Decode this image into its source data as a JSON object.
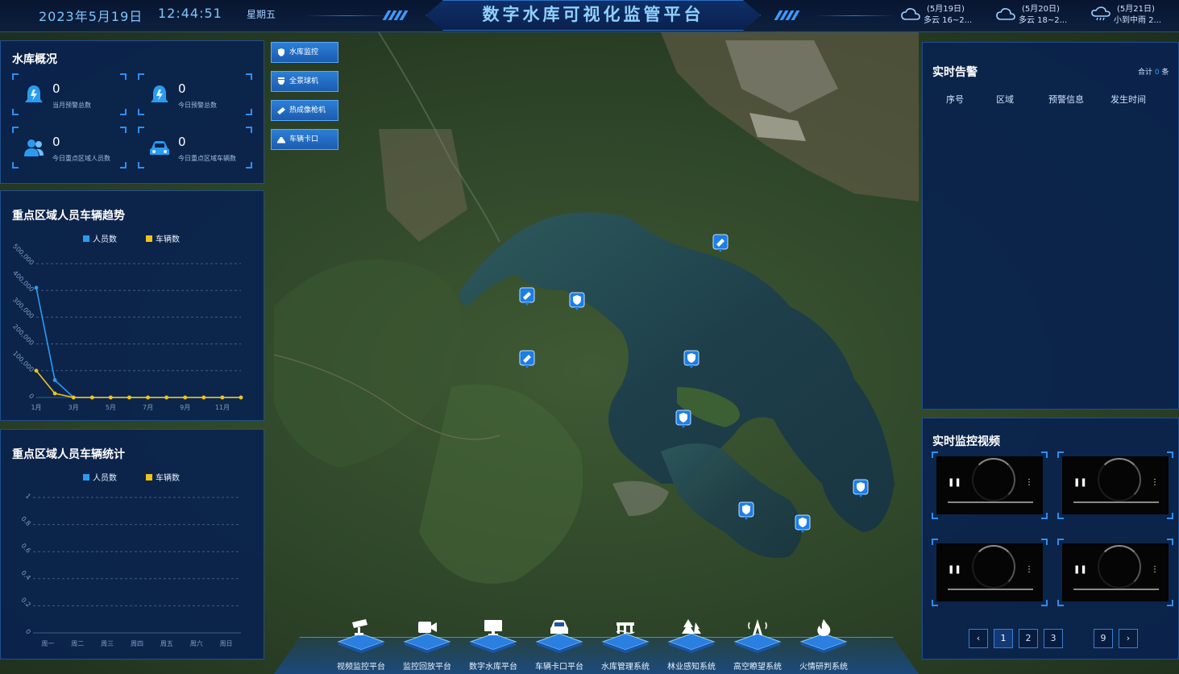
{
  "header": {
    "date": "2023年5月19日",
    "time": "12:44:51",
    "weekday": "星期五",
    "title": "数字水库可视化监管平台",
    "weather": [
      {
        "date": "(5月19日)",
        "desc": "多云 16~2...",
        "icon": "cloud-icon"
      },
      {
        "date": "(5月20日)",
        "desc": "多云 18~2...",
        "icon": "cloud-icon"
      },
      {
        "date": "(5月21日)",
        "desc": "小到中雨 2...",
        "icon": "rain-cloud-icon"
      }
    ]
  },
  "overview": {
    "title": "水库概况",
    "cards": [
      {
        "value": "0",
        "label": "当月预警总数",
        "icon": "alarm-bell-icon"
      },
      {
        "value": "0",
        "label": "今日预警总数",
        "icon": "alarm-bell-icon"
      },
      {
        "value": "0",
        "label": "今日重点区域人员数",
        "icon": "people-icon"
      },
      {
        "value": "0",
        "label": "今日重点区域车辆数",
        "icon": "car-icon"
      }
    ]
  },
  "layers": [
    {
      "label": "水库监控",
      "icon": "shield-icon"
    },
    {
      "label": "全景球机",
      "icon": "dome-camera-icon"
    },
    {
      "label": "热成像枪机",
      "icon": "gun-camera-icon"
    },
    {
      "label": "车辆卡口",
      "icon": "vehicle-gate-icon"
    }
  ],
  "trend": {
    "title": "重点区域人员车辆趋势",
    "chart_data": {
      "type": "line",
      "title": "",
      "xlabel": "",
      "ylabel": "",
      "x": [
        "1月",
        "2月",
        "3月",
        "4月",
        "5月",
        "6月",
        "7月",
        "8月",
        "9月",
        "10月",
        "11月",
        "12月"
      ],
      "x_tick_labels": [
        "1月",
        "3月",
        "5月",
        "7月",
        "9月",
        "11月"
      ],
      "y_tick_labels": [
        "0",
        "100,000",
        "200,000",
        "300,000",
        "400,000",
        "500,000"
      ],
      "ylim": [
        0,
        500000
      ],
      "legend": "top",
      "grid": true,
      "series": [
        {
          "name": "人员数",
          "color": "#2a9bf0",
          "values": [
            410000,
            65000,
            0,
            0,
            0,
            0,
            0,
            0,
            0,
            0,
            0,
            0
          ]
        },
        {
          "name": "车辆数",
          "color": "#f2c21c",
          "values": [
            100000,
            15000,
            0,
            0,
            0,
            0,
            0,
            0,
            0,
            0,
            0,
            0
          ]
        }
      ]
    }
  },
  "stats": {
    "title": "重点区域人员车辆统计",
    "chart_data": {
      "type": "bar",
      "title": "",
      "xlabel": "",
      "ylabel": "",
      "categories": [
        "周一",
        "周二",
        "周三",
        "周四",
        "周五",
        "周六",
        "周日"
      ],
      "y_tick_labels": [
        "0",
        "0.2",
        "0.4",
        "0.6",
        "0.8",
        "1"
      ],
      "ylim": [
        0,
        1
      ],
      "legend": "top",
      "grid": true,
      "series": [
        {
          "name": "人员数",
          "color": "#2a9bf0",
          "values": [
            0,
            0,
            0,
            0,
            0,
            0,
            0
          ]
        },
        {
          "name": "车辆数",
          "color": "#f2c21c",
          "values": [
            0,
            0,
            0,
            0,
            0,
            0,
            0
          ]
        }
      ]
    }
  },
  "alarm": {
    "title": "实时告警",
    "total_prefix": "合计",
    "total": "0",
    "total_suffix": "条",
    "columns": [
      "序号",
      "区域",
      "预警信息",
      "发生时间"
    ]
  },
  "video": {
    "title": "实时监控视频",
    "pages": [
      "1",
      "2",
      "3",
      "9"
    ],
    "prev": "‹",
    "next": "›"
  },
  "dock": [
    {
      "label": "视频监控平台",
      "icon": "cctv-icon"
    },
    {
      "label": "监控回放平台",
      "icon": "video-playback-icon"
    },
    {
      "label": "数字水库平台",
      "icon": "monitor-icon"
    },
    {
      "label": "车辆卡口平台",
      "icon": "car-icon"
    },
    {
      "label": "水库管理系统",
      "icon": "dam-icon"
    },
    {
      "label": "林业感知系统",
      "icon": "forest-icon"
    },
    {
      "label": "高空瞭望系统",
      "icon": "lookout-icon"
    },
    {
      "label": "火情研判系统",
      "icon": "fire-icon"
    }
  ],
  "colors": {
    "accent": "#2f8ef0",
    "panel_bg": "#0a224e",
    "person": "#2a9bf0",
    "vehicle": "#f2c21c"
  }
}
